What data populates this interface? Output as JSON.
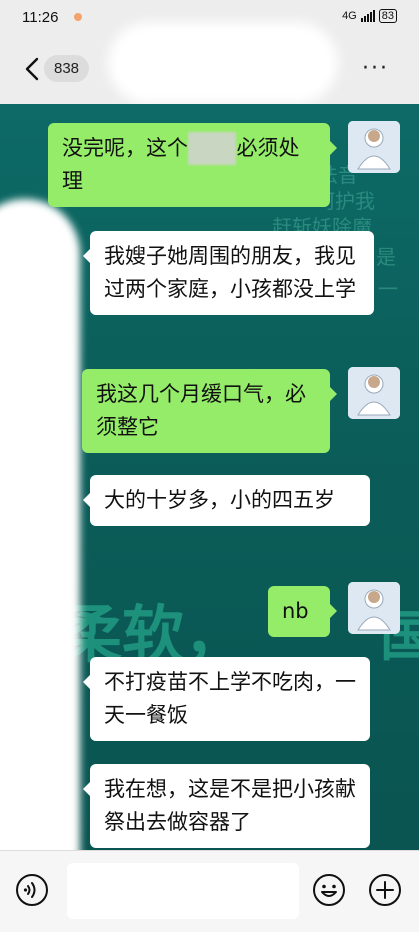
{
  "status_bar": {
    "time": "11:26",
    "network": "4G",
    "battery": "83"
  },
  "header": {
    "unread_count": "838",
    "more_label": "···"
  },
  "background_watermark": {
    "lines": [
      "法音",
      "呵护我",
      "赶斩妖除魔",
      "是",
      "一"
    ],
    "big_text": "柔软，",
    "big_text_right": "国"
  },
  "messages": [
    {
      "side": "out",
      "text_before": "没完呢，这个",
      "redacted": "▓▓▓",
      "text_after": "必须处理"
    },
    {
      "side": "in",
      "text": "我嫂子她周围的朋友，我见过两个家庭，小孩都没上学"
    },
    {
      "side": "out",
      "text": "我这几个月缓口气，必须整它"
    },
    {
      "side": "in",
      "text": "大的十岁多，小的四五岁"
    },
    {
      "side": "out",
      "text": "nb"
    },
    {
      "side": "in",
      "text": "不打疫苗不上学不吃肉，一天一餐饭"
    },
    {
      "side": "in",
      "text": "我在想，这是不是把小孩献祭出去做容器了"
    }
  ],
  "input_bar": {
    "placeholder": ""
  },
  "colors": {
    "outgoing_bubble": "#95ec69",
    "incoming_bubble": "#ffffff",
    "chat_background": "#0b5e5a"
  }
}
